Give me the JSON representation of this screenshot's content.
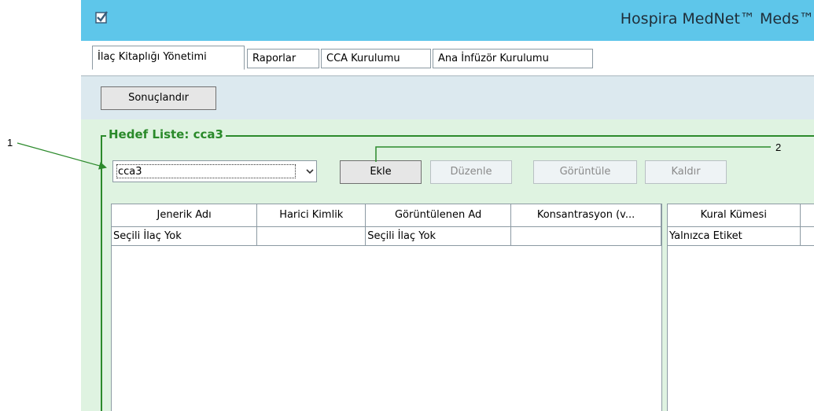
{
  "callouts": {
    "one": "1",
    "two": "2"
  },
  "window": {
    "title": "Hospira MedNet™ Meds™",
    "icon": "app-checkbox-icon"
  },
  "tabs": [
    {
      "label": "İlaç Kitaplığı Yönetimi",
      "active": true
    },
    {
      "label": "Raporlar"
    },
    {
      "label": "CCA Kurulumu"
    },
    {
      "label": "Ana İnfüzör Kurulumu"
    }
  ],
  "toolbar": {
    "finalize_label": "Sonuçlandır"
  },
  "target_list": {
    "title": "Hedef Liste: cca3",
    "selected": "cca3",
    "add_label": "Ekle",
    "edit_label": "Düzenle",
    "view_label": "Görüntüle",
    "remove_label": "Kaldır"
  },
  "drug_table": {
    "headers": [
      "Jenerik Adı",
      "Harici Kimlik",
      "Görüntülenen Ad",
      "Konsantrasyon (v..."
    ],
    "rows": [
      [
        "Seçili İlaç Yok",
        "",
        "Seçili İlaç Yok",
        ""
      ]
    ]
  },
  "rule_table": {
    "headers": [
      "Kural Kümesi"
    ],
    "rows": [
      [
        "Yalnızca Etiket"
      ]
    ]
  },
  "colors": {
    "titlebar": "#5ec6ea",
    "group_border": "#2c8a2c",
    "panel_bg": "#dff3e1",
    "callout_line": "#2c8a2c"
  }
}
